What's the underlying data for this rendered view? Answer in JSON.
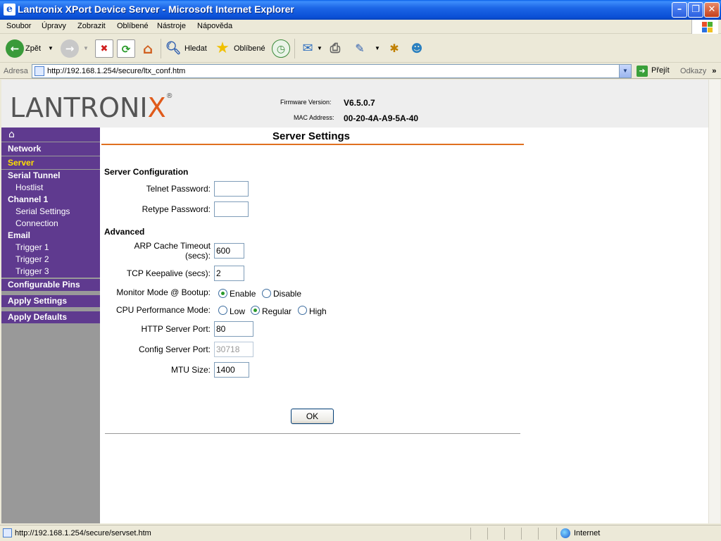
{
  "window": {
    "title": "Lantronix XPort Device Server - Microsoft Internet Explorer"
  },
  "menu": [
    "Soubor",
    "Úpravy",
    "Zobrazit",
    "Oblíbené",
    "Nástroje",
    "Nápověda"
  ],
  "toolbar": {
    "back_label": "Zpět",
    "search_label": "Hledat",
    "favorites_label": "Oblíbené"
  },
  "address": {
    "label": "Adresa",
    "url": "http://192.168.1.254/secure/ltx_conf.htm",
    "go_label": "Přejít",
    "links_label": "Odkazy"
  },
  "header": {
    "logo_text": "LANTRONIX",
    "firmware_label": "Firmware Version:",
    "firmware_value": "V6.5.0.7",
    "mac_label": "MAC Address:",
    "mac_value": "00-20-4A-A9-5A-40"
  },
  "sidebar": {
    "items": [
      {
        "label": "Network",
        "level": "main",
        "active": false
      },
      {
        "label": "Server",
        "level": "main",
        "active": true
      },
      {
        "label": "Serial Tunnel",
        "level": "main",
        "active": false
      },
      {
        "label": "Hostlist",
        "level": "sub",
        "active": false
      },
      {
        "label": "Channel 1",
        "level": "main",
        "active": false
      },
      {
        "label": "Serial Settings",
        "level": "sub",
        "active": false
      },
      {
        "label": "Connection",
        "level": "sub",
        "active": false
      },
      {
        "label": "Email",
        "level": "main",
        "active": false
      },
      {
        "label": "Trigger 1",
        "level": "sub",
        "active": false
      },
      {
        "label": "Trigger 2",
        "level": "sub",
        "active": false
      },
      {
        "label": "Trigger 3",
        "level": "sub",
        "active": false
      },
      {
        "label": "Configurable Pins",
        "level": "main",
        "active": false
      },
      {
        "label": "Apply Settings",
        "level": "main",
        "active": false
      },
      {
        "label": "Apply Defaults",
        "level": "main",
        "active": false
      }
    ]
  },
  "page": {
    "title": "Server Settings",
    "section_config": "Server Configuration",
    "telnet_password_label": "Telnet Password:",
    "telnet_password_value": "",
    "retype_password_label": "Retype Password:",
    "retype_password_value": "",
    "section_advanced": "Advanced",
    "arp_label_1": "ARP Cache Timeout",
    "arp_label_2": "(secs):",
    "arp_value": "600",
    "tcp_keepalive_label": "TCP Keepalive (secs):",
    "tcp_keepalive_value": "2",
    "monitor_mode_label": "Monitor Mode @ Bootup:",
    "monitor_mode_options": [
      "Enable",
      "Disable"
    ],
    "monitor_mode_selected": "Enable",
    "cpu_mode_label": "CPU Performance Mode:",
    "cpu_mode_options": [
      "Low",
      "Regular",
      "High"
    ],
    "cpu_mode_selected": "Regular",
    "http_port_label": "HTTP Server Port:",
    "http_port_value": "80",
    "config_port_label": "Config Server Port:",
    "config_port_value": "30718",
    "mtu_label": "MTU Size:",
    "mtu_value": "1400",
    "ok_label": "OK"
  },
  "status": {
    "url": "http://192.168.1.254/secure/servset.htm",
    "zone": "Internet"
  },
  "colors": {
    "sidebar_bg": "#5f3a8f",
    "sidebar_active": "#ffe000",
    "title_underline": "#e07020",
    "logo_accent": "#e05a1a"
  }
}
